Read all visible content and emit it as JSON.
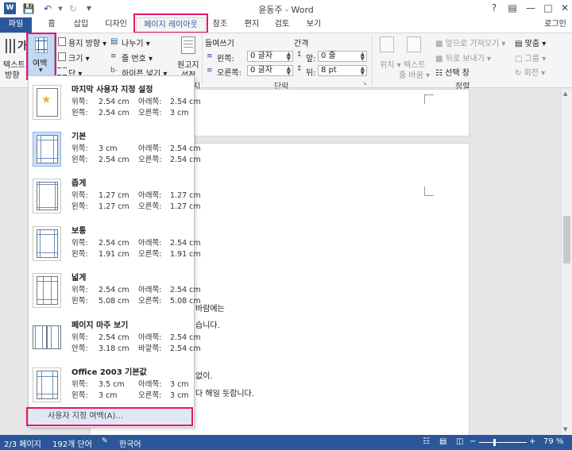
{
  "titlebar": {
    "title": "윤동주 - Word",
    "help": "?"
  },
  "tabs": [
    "파일",
    "홈",
    "삽입",
    "디자인",
    "페이지 레이아웃",
    "참조",
    "편지",
    "검토",
    "보기"
  ],
  "account": "로그인",
  "ribbon": {
    "text_direction": [
      "텍스트",
      "방향"
    ],
    "margins": "여백",
    "orientation": "용지 방향",
    "size": "크기",
    "columns": "단",
    "breaks": "나누기",
    "line_numbers": "줄 번호",
    "hyphenation": "하이픈 넣기",
    "watermark_label": [
      "원고지",
      "설정"
    ],
    "indent_title": "들여쓰기",
    "indent_left_label": "왼쪽:",
    "indent_left_value": "0 글자",
    "indent_right_label": "오른쪽:",
    "indent_right_value": "0 글자",
    "spacing_title": "간격",
    "spacing_before_label": "앞:",
    "spacing_before_value": "0 줄",
    "spacing_after_label": "뒤:",
    "spacing_after_value": "8 pt",
    "paragraph_group": "단락",
    "partial_group": "지",
    "position": "위치",
    "wrap_text": [
      "텍스트",
      "줄 바꿈"
    ],
    "bring_forward": "앞으로 가져오기",
    "send_backward": "뒤로 보내기",
    "selection_pane": "선택 창",
    "align": "맞춤",
    "group": "그룹",
    "rotate": "회전",
    "arrange_group": "정렬"
  },
  "margins_menu": {
    "items": [
      {
        "name": "마지막 사용자 지정 설정",
        "top_label": "위쪽:",
        "top": "2.54 cm",
        "bottom_label": "아래쪽:",
        "bottom": "2.54 cm",
        "left_label": "왼쪽:",
        "left": "2.54 cm",
        "right_label": "오른쪽:",
        "right": "3 cm"
      },
      {
        "name": "기본",
        "top_label": "위쪽:",
        "top": "3 cm",
        "bottom_label": "아래쪽:",
        "bottom": "2.54 cm",
        "left_label": "왼쪽:",
        "left": "2.54 cm",
        "right_label": "오른쪽:",
        "right": "2.54 cm"
      },
      {
        "name": "좁게",
        "top_label": "위쪽:",
        "top": "1.27 cm",
        "bottom_label": "아래쪽:",
        "bottom": "1.27 cm",
        "left_label": "왼쪽:",
        "left": "1.27 cm",
        "right_label": "오른쪽:",
        "right": "1.27 cm"
      },
      {
        "name": "보통",
        "top_label": "위쪽:",
        "top": "2.54 cm",
        "bottom_label": "아래쪽:",
        "bottom": "2.54 cm",
        "left_label": "왼쪽:",
        "left": "1.91 cm",
        "right_label": "오른쪽:",
        "right": "1.91 cm"
      },
      {
        "name": "넓게",
        "top_label": "위쪽:",
        "top": "2.54 cm",
        "bottom_label": "아래쪽:",
        "bottom": "2.54 cm",
        "left_label": "왼쪽:",
        "left": "5.08 cm",
        "right_label": "오른쪽:",
        "right": "5.08 cm"
      },
      {
        "name": "페이지 마주 보기",
        "top_label": "위쪽:",
        "top": "2.54 cm",
        "bottom_label": "아래쪽:",
        "bottom": "2.54 cm",
        "left_label": "안쪽:",
        "left": "3.18 cm",
        "right_label": "바깥쪽:",
        "right": "2.54 cm"
      },
      {
        "name": "Office 2003 기본값",
        "top_label": "위쪽:",
        "top": "3.5 cm",
        "bottom_label": "아래쪽:",
        "bottom": "3 cm",
        "left_label": "왼쪽:",
        "left": "3 cm",
        "right_label": "오른쪽:",
        "right": "3 cm"
      }
    ],
    "custom": "사용자 지정 여백(A)..."
  },
  "document": {
    "lines": [
      "바람에는",
      "습니다.",
      "없이.",
      "다 해일 듯합니다."
    ]
  },
  "status": {
    "page": "2/3 페이지",
    "words": "192개 단어",
    "language": "한국어",
    "zoom": "79 %"
  },
  "colors": {
    "accent": "#2b579a",
    "highlight": "#e8146c"
  }
}
